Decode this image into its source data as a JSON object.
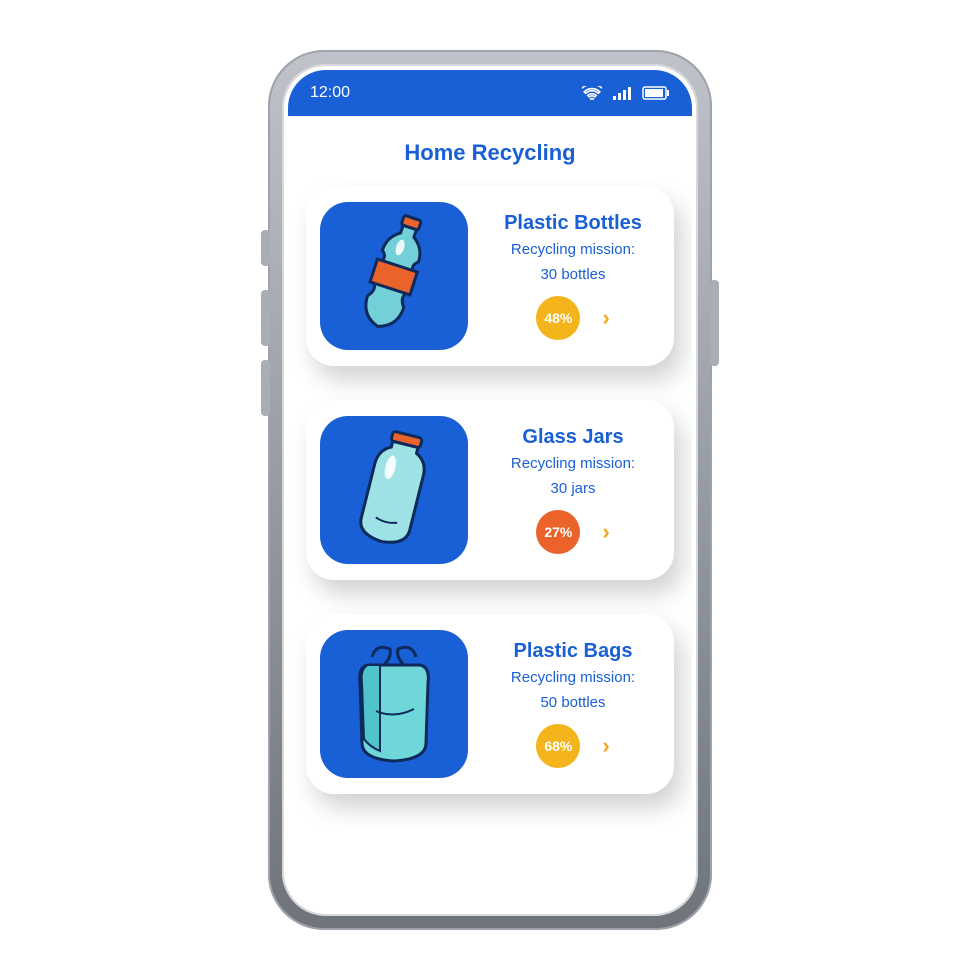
{
  "status": {
    "time": "12:00"
  },
  "header": {
    "title": "Home Recycling"
  },
  "cards": [
    {
      "title": "Plastic Bottles",
      "mission_line1": "Recycling mission:",
      "mission_line2": "30 bottles",
      "progress": "48%",
      "badge_color": "#f4b41b",
      "icon": "plastic-bottle-icon"
    },
    {
      "title": "Glass Jars",
      "mission_line1": "Recycling mission:",
      "mission_line2": "30 jars",
      "progress": "27%",
      "badge_color": "#e9632a",
      "icon": "glass-jar-icon"
    },
    {
      "title": "Plastic Bags",
      "mission_line1": "Recycling mission:",
      "mission_line2": "50 bottles",
      "progress": "68%",
      "badge_color": "#f4b41b",
      "icon": "plastic-bag-icon"
    }
  ]
}
